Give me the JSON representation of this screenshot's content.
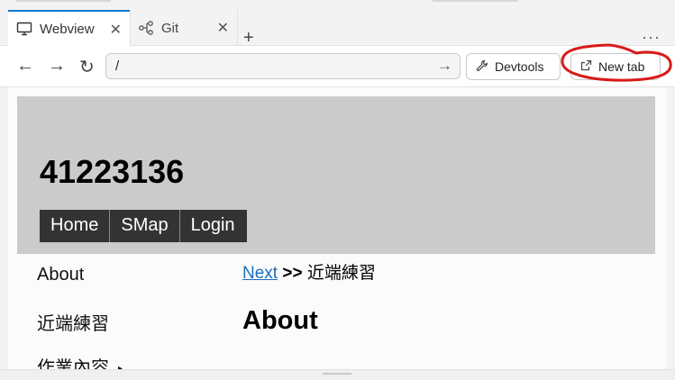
{
  "tabs": [
    {
      "label": "Webview",
      "icon": "monitor-icon",
      "active": true
    },
    {
      "label": "Git",
      "icon": "git-graph-icon",
      "active": false
    }
  ],
  "toolbar": {
    "url": "/",
    "devtools_label": "Devtools",
    "newtab_label": "New tab",
    "annotation_color": "#d91a1a",
    "accent": "#0f7bd4"
  },
  "site": {
    "title": "41223136",
    "menu": [
      "Home",
      "SMap",
      "Login"
    ],
    "sidebar": [
      "About",
      "近端練習",
      "作業內容"
    ],
    "breadcrumb": {
      "next": "Next",
      "sep": ">>",
      "current": "近端練習"
    },
    "heading": "About"
  }
}
